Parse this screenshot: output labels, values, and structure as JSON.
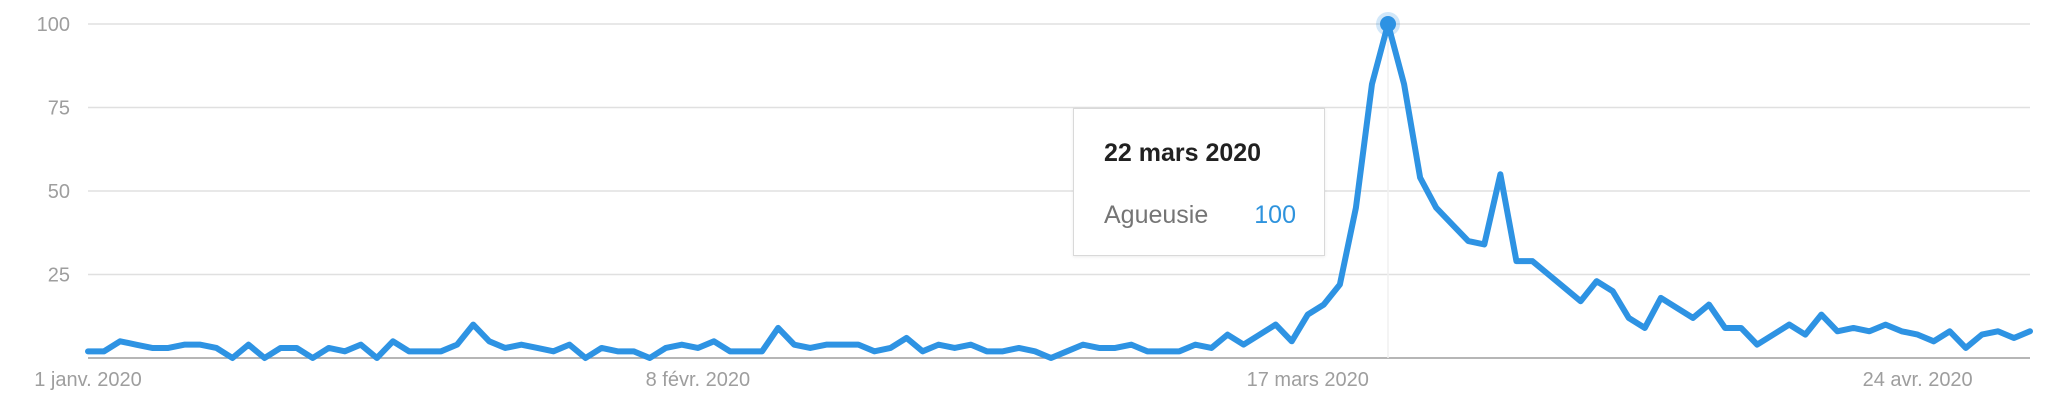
{
  "chart_data": {
    "type": "line",
    "title": "",
    "xlabel": "",
    "ylabel": "",
    "ylim": [
      0,
      100
    ],
    "y_ticks": [
      100,
      75,
      50,
      25
    ],
    "x_tick_labels": [
      {
        "label": "1 janv. 2020",
        "index": 0
      },
      {
        "label": "8 févr. 2020",
        "index": 38
      },
      {
        "label": "17 mars 2020",
        "index": 76
      },
      {
        "label": "24 avr. 2020",
        "index": 114
      }
    ],
    "grid": true,
    "legend": "none",
    "series": [
      {
        "name": "Agueusie",
        "color": "#2e93e3",
        "values": [
          2,
          2,
          5,
          4,
          3,
          3,
          4,
          4,
          3,
          0,
          4,
          0,
          3,
          3,
          0,
          3,
          2,
          4,
          0,
          5,
          2,
          2,
          2,
          4,
          10,
          5,
          3,
          4,
          3,
          2,
          4,
          0,
          3,
          2,
          2,
          0,
          3,
          4,
          3,
          5,
          2,
          2,
          2,
          9,
          4,
          3,
          4,
          4,
          4,
          2,
          3,
          6,
          2,
          4,
          3,
          4,
          2,
          2,
          3,
          2,
          0,
          2,
          4,
          3,
          3,
          4,
          2,
          2,
          2,
          4,
          3,
          7,
          4,
          7,
          10,
          5,
          13,
          16,
          22,
          45,
          82,
          100,
          82,
          54,
          45,
          40,
          35,
          34,
          55,
          29,
          29,
          25,
          21,
          17,
          23,
          20,
          12,
          9,
          18,
          15,
          12,
          16,
          9,
          9,
          4,
          7,
          10,
          7,
          13,
          8,
          9,
          8,
          10,
          8,
          7,
          5,
          8,
          3,
          7,
          8,
          6,
          8
        ]
      }
    ],
    "tooltip": {
      "date": "22 mars 2020",
      "series_name": "Agueusie",
      "value": "100",
      "index": 81
    },
    "colors": {
      "line": "#2e93e3",
      "grid": "#e0e0e0",
      "axis": "#9e9e9e",
      "tick_label": "#9e9e9e",
      "tooltip_value": "#2e93dd"
    }
  }
}
